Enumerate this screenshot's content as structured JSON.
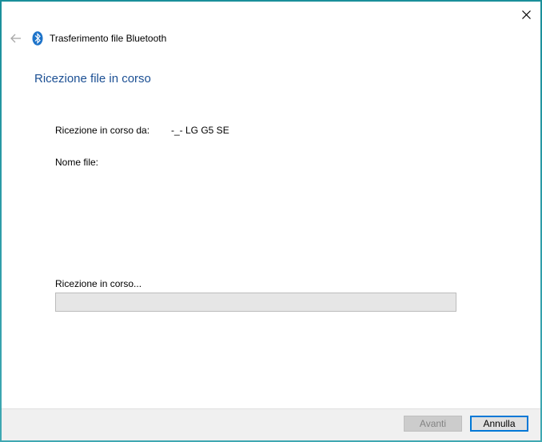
{
  "window": {
    "title": "Trasferimento file Bluetooth",
    "close_icon": "close-icon",
    "back_icon": "back-arrow-icon",
    "app_icon": "bluetooth-icon"
  },
  "main": {
    "heading": "Ricezione file in corso",
    "from_label": "Ricezione in corso da:",
    "from_value": "-_- LG G5 SE",
    "file_label": "Nome file:",
    "progress_label": "Ricezione in corso...",
    "progress_value": 0
  },
  "footer": {
    "next_label": "Avanti",
    "cancel_label": "Annulla"
  },
  "colors": {
    "heading": "#1b4f93",
    "accent": "#0078d7",
    "desktop": "#2a9aa6"
  }
}
